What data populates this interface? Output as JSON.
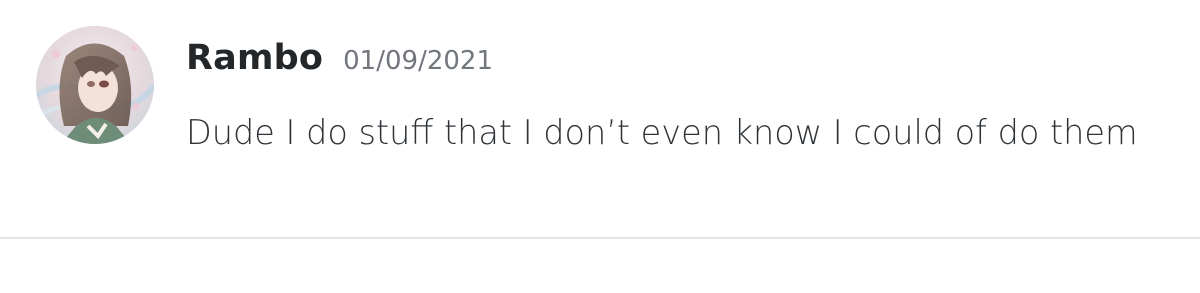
{
  "message": {
    "username": "Rambo",
    "timestamp": "01/09/2021",
    "content": "Dude I do stuff that I don’t even know I could of do them",
    "avatar_icon": "user-avatar-anime-girl"
  },
  "colors": {
    "username": "#23272a",
    "timestamp": "#72767d",
    "content": "#2e3338",
    "divider": "#e3e5e8",
    "background": "#ffffff"
  }
}
